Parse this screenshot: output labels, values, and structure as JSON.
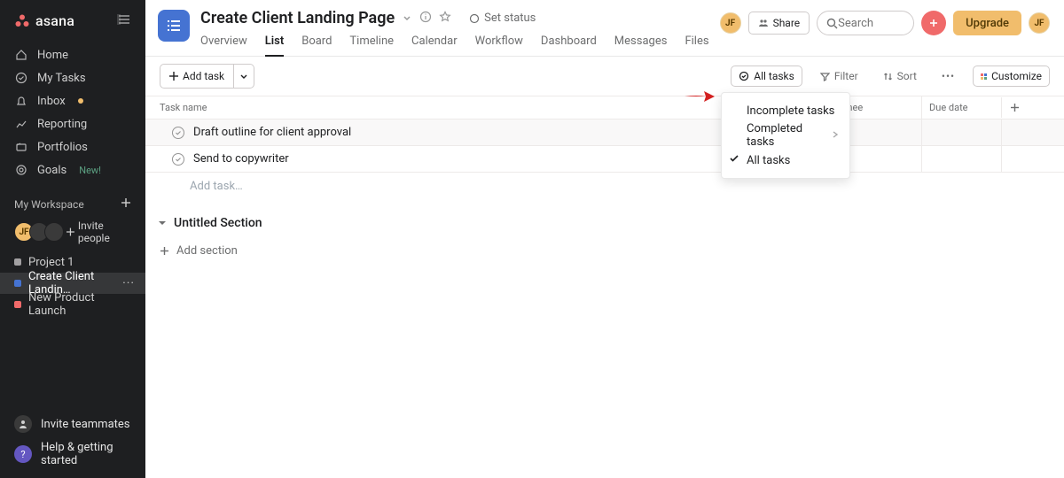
{
  "brand": {
    "name": "asana"
  },
  "nav": {
    "home": "Home",
    "my_tasks": "My Tasks",
    "inbox": "Inbox",
    "reporting": "Reporting",
    "portfolios": "Portfolios",
    "goals": "Goals",
    "goals_badge": "New!"
  },
  "workspace": {
    "title": "My Workspace",
    "invite_people": "Invite people",
    "avatar_initials": "JF",
    "projects": [
      {
        "name": "Project 1",
        "color": "#a2a0a2",
        "active": false
      },
      {
        "name": "Create Client Landin…",
        "color": "#4573d2",
        "active": true
      },
      {
        "name": "New Product Launch",
        "color": "#f06a6a",
        "active": false
      }
    ]
  },
  "sidebar_footer": {
    "invite_teammates": "Invite teammates",
    "help": "Help & getting started"
  },
  "header": {
    "project_title": "Create Client Landing Page",
    "set_status": "Set status",
    "tabs": [
      "Overview",
      "List",
      "Board",
      "Timeline",
      "Calendar",
      "Workflow",
      "Dashboard",
      "Messages",
      "Files"
    ],
    "active_tab": "List",
    "share": "Share",
    "search_placeholder": "Search",
    "upgrade": "Upgrade",
    "avatar_initials": "JF"
  },
  "toolbar": {
    "add_task": "Add task",
    "all_tasks": "All tasks",
    "filter": "Filter",
    "sort": "Sort",
    "customize": "Customize"
  },
  "filter_dropdown": {
    "incomplete": "Incomplete tasks",
    "completed": "Completed tasks",
    "all": "All tasks"
  },
  "columns": {
    "task_name": "Task name",
    "assignee": "Assignee",
    "due_date": "Due date"
  },
  "tasks": [
    "Draft outline for client approval",
    "Send to copywriter"
  ],
  "add_task_inline": "Add task…",
  "section": {
    "untitled": "Untitled Section",
    "add_section": "Add section"
  },
  "colors": {
    "accent": "#4573d2",
    "amber": "#f1bd6c",
    "coral": "#f06a6a"
  }
}
